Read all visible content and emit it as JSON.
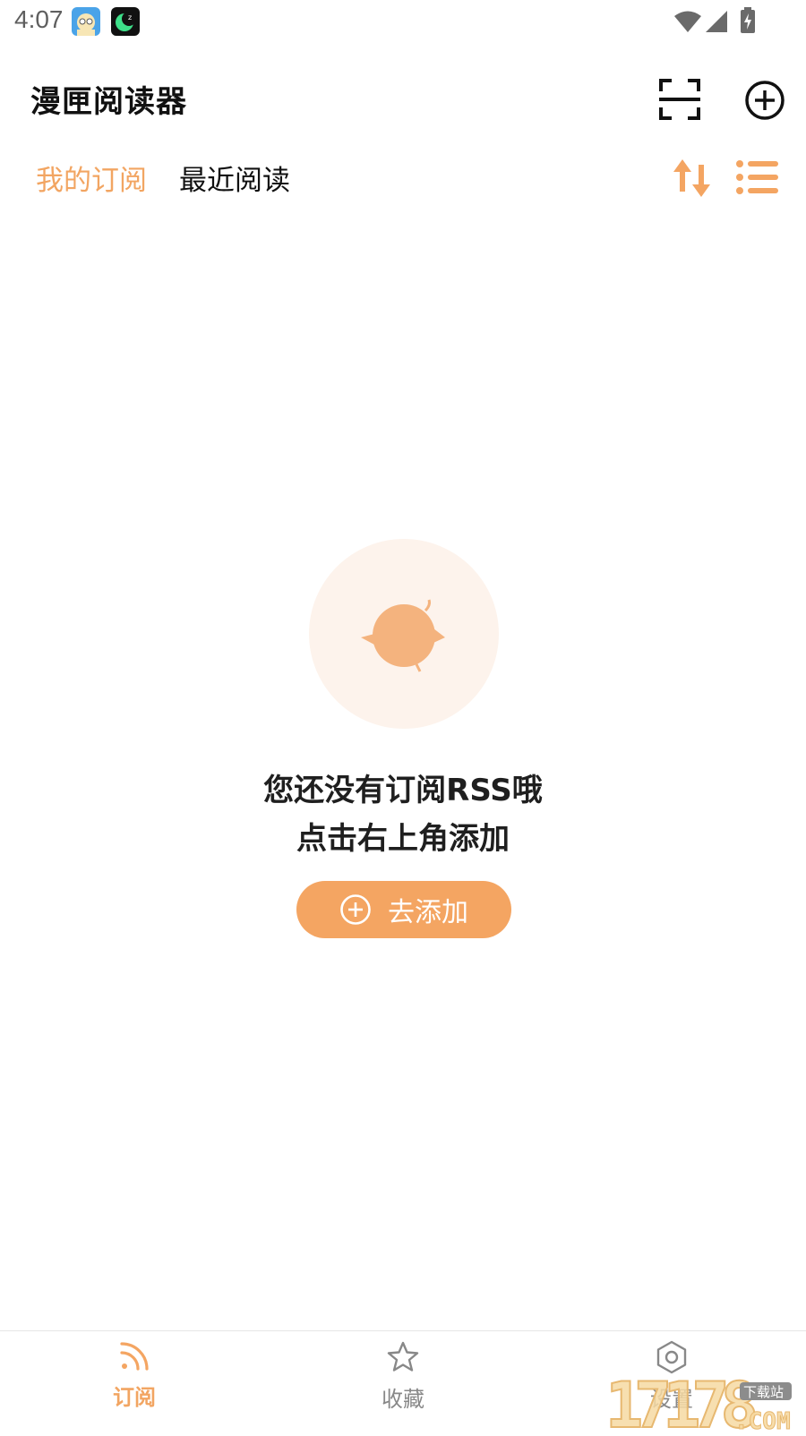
{
  "status_bar": {
    "time": "4:07",
    "notification_icons": [
      "app-avatar-icon",
      "moon-sleep-icon"
    ],
    "system_icons": [
      "wifi-icon",
      "cellular-signal-icon",
      "battery-charging-icon"
    ]
  },
  "app_bar": {
    "title": "漫匣阅读器",
    "actions": [
      "scan-icon",
      "add-circle-icon"
    ]
  },
  "tabs": [
    {
      "label": "我的订阅",
      "selected": true
    },
    {
      "label": "最近阅读",
      "selected": false
    }
  ],
  "tab_actions": [
    "sort-icon",
    "list-view-icon"
  ],
  "empty_state": {
    "line1": "您还没有订阅RSS哦",
    "line2": "点击右上角添加",
    "button_label": "去添加"
  },
  "bottom_nav": [
    {
      "label": "订阅",
      "icon": "rss-icon",
      "active": true
    },
    {
      "label": "收藏",
      "icon": "star-icon",
      "active": false
    },
    {
      "label": "设置",
      "icon": "settings-hex-icon",
      "active": false
    }
  ],
  "watermark": {
    "text": "17178",
    "suffix": ".COM",
    "tag": "下载站"
  },
  "colors": {
    "accent": "#f4a562",
    "accent_light": "#fdf3ec",
    "text": "#1a1a1a"
  }
}
